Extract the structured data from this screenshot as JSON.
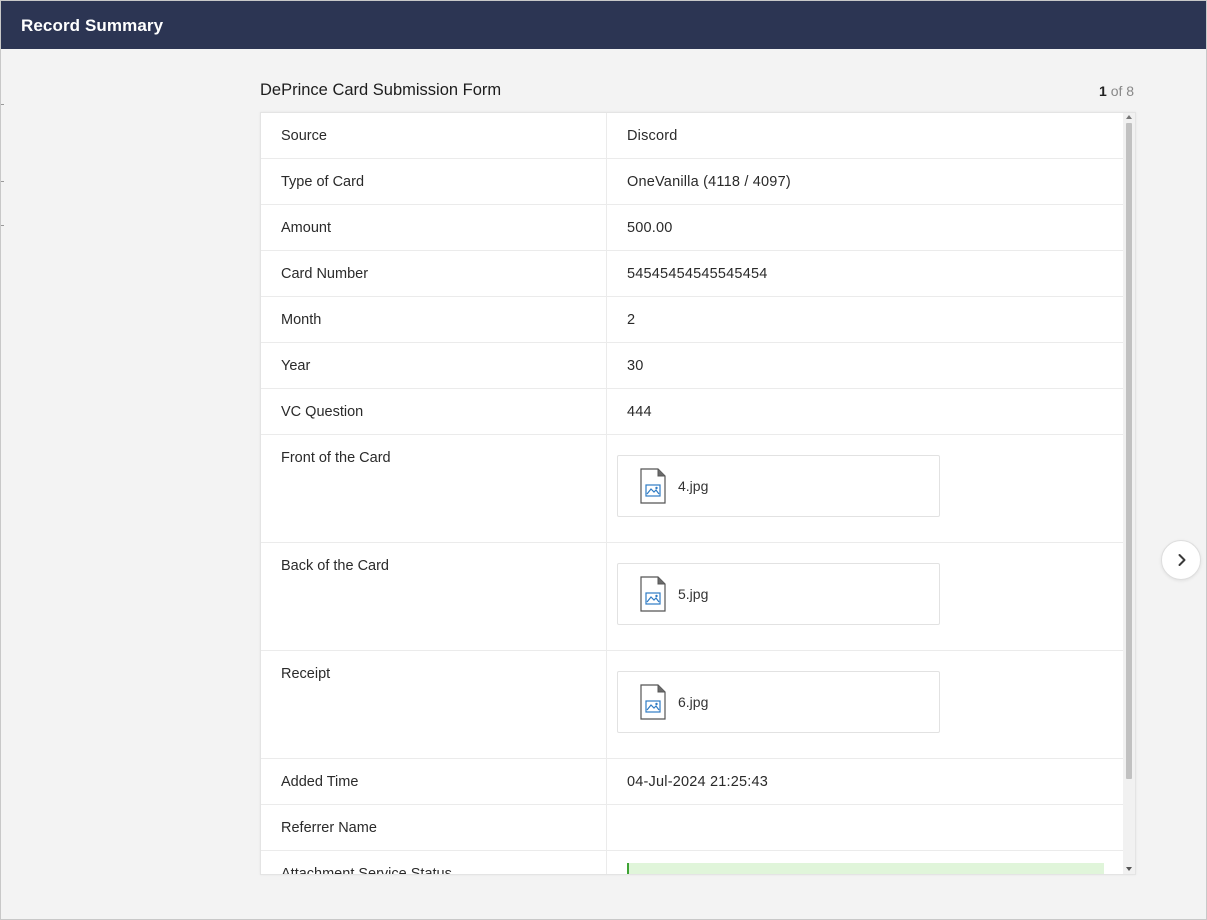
{
  "window": {
    "title": "Record Summary"
  },
  "form": {
    "title": "DePrince Card Submission Form",
    "pager": {
      "current": "1",
      "separator": "of",
      "total": "8"
    }
  },
  "fields": [
    {
      "label": "Source",
      "value": "Discord",
      "type": "text"
    },
    {
      "label": "Type of Card",
      "value": "OneVanilla (4118 / 4097)",
      "type": "text"
    },
    {
      "label": "Amount",
      "value": "500.00",
      "type": "text"
    },
    {
      "label": "Card Number",
      "value": "54545454545545454",
      "type": "text"
    },
    {
      "label": "Month",
      "value": "2",
      "type": "text"
    },
    {
      "label": "Year",
      "value": "30",
      "type": "text"
    },
    {
      "label": "VC Question",
      "value": "444",
      "type": "text"
    },
    {
      "label": "Front of the Card",
      "value": "4.jpg",
      "type": "file",
      "icon": "image-file-icon"
    },
    {
      "label": "Back of the Card",
      "value": "5.jpg",
      "type": "file",
      "icon": "image-file-icon"
    },
    {
      "label": "Receipt",
      "value": "6.jpg",
      "type": "file",
      "icon": "image-file-icon"
    },
    {
      "label": "Added Time",
      "value": "04-Jul-2024 21:25:43",
      "type": "text"
    },
    {
      "label": "Referrer Name",
      "value": "",
      "type": "text"
    },
    {
      "label": "Attachment Service Status",
      "value": "",
      "type": "status"
    }
  ],
  "icons": {
    "next": "chevron-right-icon",
    "file": "image-file-icon"
  },
  "colors": {
    "titlebar": "#2c3553",
    "status_fill": "#e0f5da",
    "status_accent": "#3ea335",
    "file_icon_accent": "#2e7bc4"
  }
}
